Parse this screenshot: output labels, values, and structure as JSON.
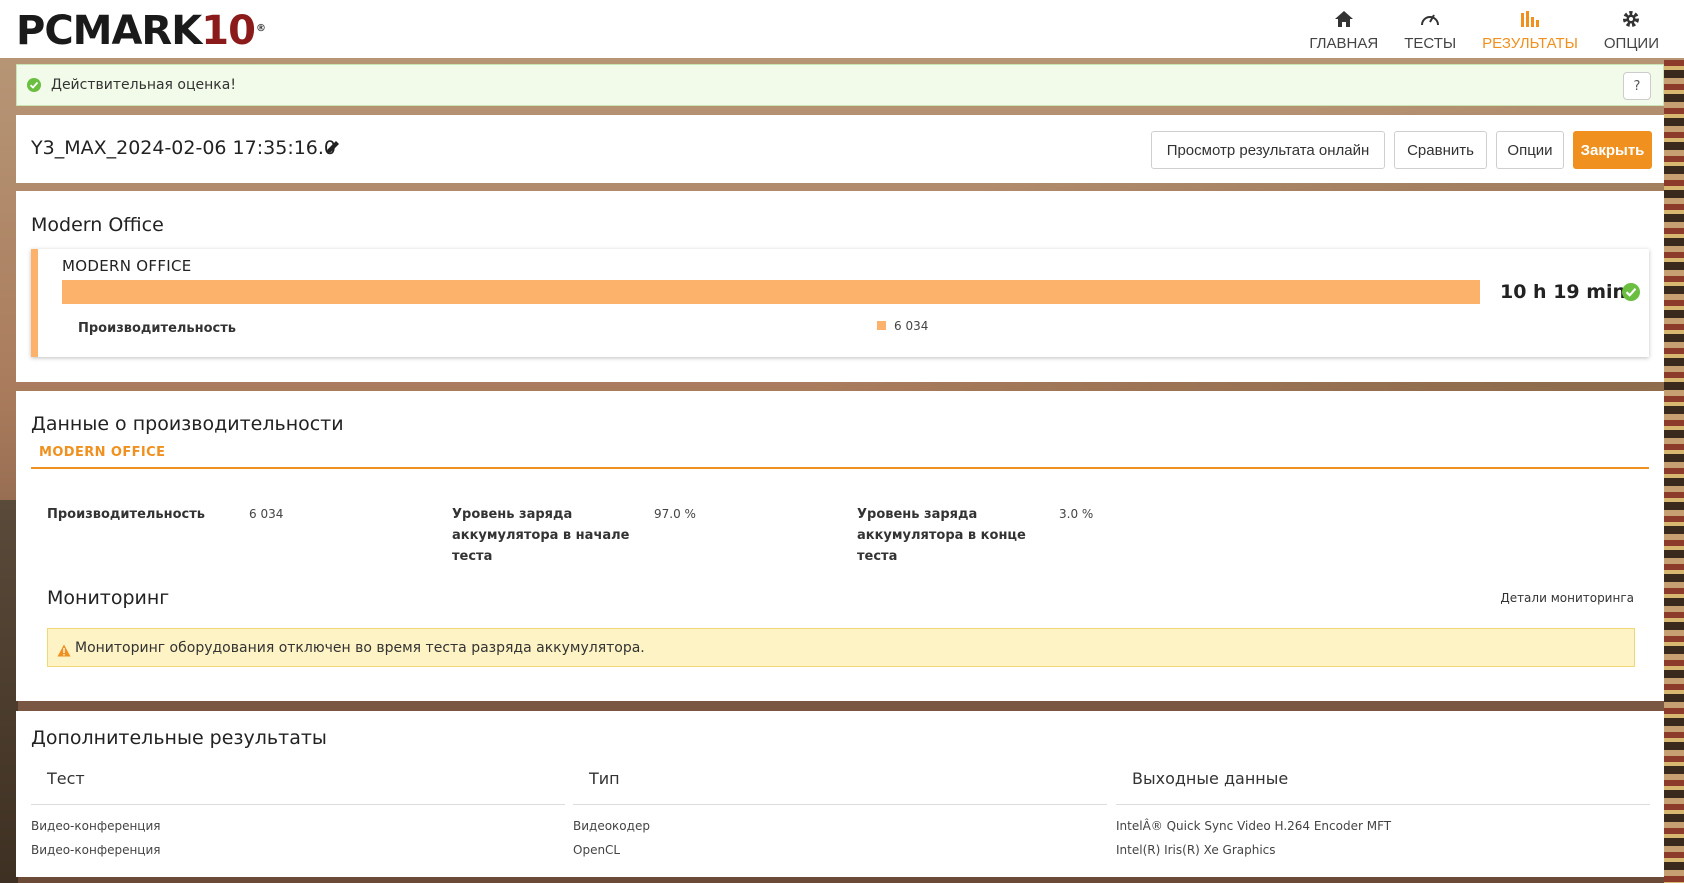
{
  "app": {
    "logo_main": "PCMARK",
    "logo_num": "10",
    "logo_reg": "®"
  },
  "nav": {
    "items": [
      {
        "label": "ГЛАВНАЯ",
        "icon": "home-icon"
      },
      {
        "label": "ТЕСТЫ",
        "icon": "gauge-icon"
      },
      {
        "label": "РЕЗУЛЬТАТЫ",
        "icon": "bar-chart-icon",
        "active": true
      },
      {
        "label": "ОПЦИИ",
        "icon": "gear-icon"
      }
    ],
    "active_color": "#f0901e"
  },
  "validation": {
    "text": "Действительная оценка!",
    "help_label": "?",
    "status_color": "#6abf40"
  },
  "result": {
    "name": "Y3_MAX_2024-02-06 17:35:16.0",
    "buttons": {
      "view_online": "Просмотр результата онлайн",
      "compare": "Сравнить",
      "options": "Опции",
      "close": "Закрыть"
    }
  },
  "modern_office": {
    "heading": "Modern Office",
    "card_title": "MODERN OFFICE",
    "score": "10 h 19 min",
    "perf_label": "Производительность",
    "perf_value": "6 034",
    "bar_color": "#fdb26b"
  },
  "perf_data": {
    "heading": "Данные о производительности",
    "tab": "MODERN OFFICE",
    "items": [
      {
        "label_lines": [
          "Производительность"
        ],
        "value": "6 034"
      },
      {
        "label_lines": [
          "Уровень заряда",
          "аккумулятора в начале",
          "теста"
        ],
        "value": "97.0 %"
      },
      {
        "label_lines": [
          "Уровень заряда",
          "аккумулятора в конце",
          "теста"
        ],
        "value": "3.0 %"
      }
    ],
    "monitoring": {
      "heading": "Мониторинг",
      "details_link": "Детали мониторинга",
      "warning": "Мониторинг оборудования отключен во время теста разряда аккумулятора."
    }
  },
  "extra": {
    "heading": "Дополнительные результаты",
    "columns": [
      "Тест",
      "Тип",
      "Выходные данные"
    ],
    "rows": [
      [
        "Видео-конференция",
        "Видеокодер",
        "IntelÂ® Quick Sync Video H.264 Encoder MFT"
      ],
      [
        "Видео-конференция",
        "OpenCL",
        "Intel(R) Iris(R) Xe Graphics"
      ]
    ]
  }
}
